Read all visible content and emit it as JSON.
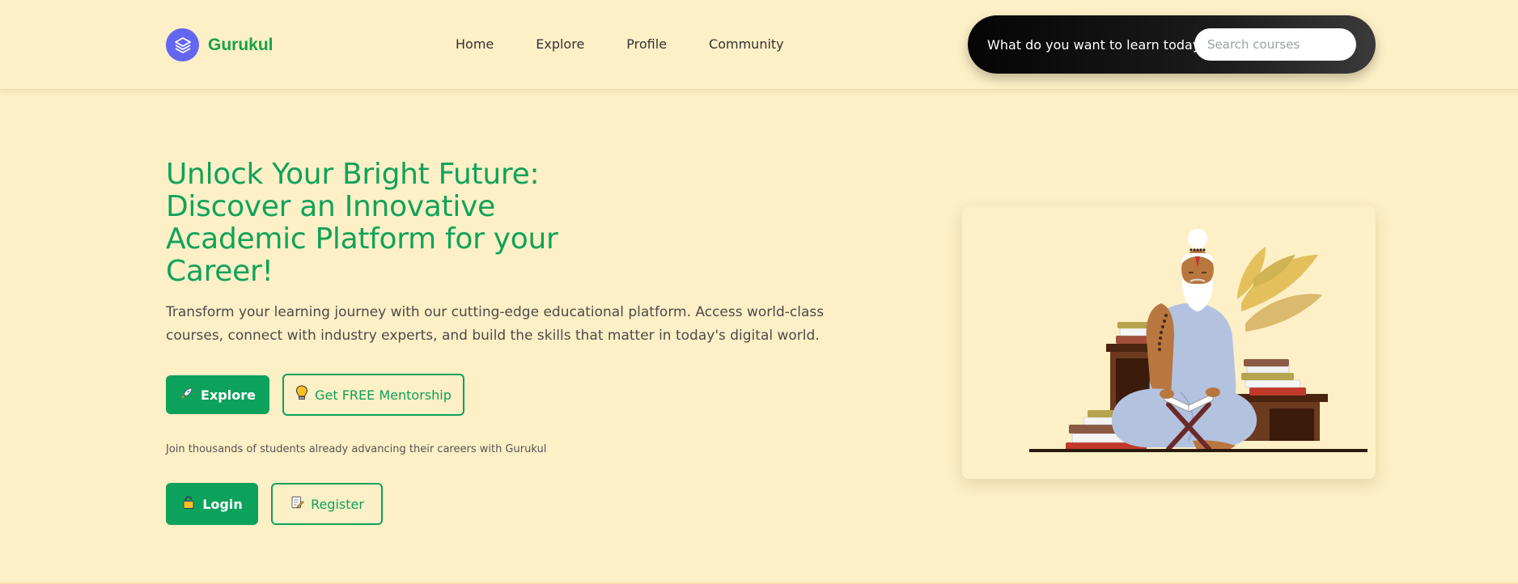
{
  "brand": {
    "name": "Gurukul",
    "logo_icon": "stack-layers-icon",
    "logo_color": "#6366f1"
  },
  "nav": {
    "items": [
      "Home",
      "Explore",
      "Profile",
      "Community"
    ]
  },
  "search": {
    "prompt": "What do you want to learn today?",
    "placeholder": "Search courses",
    "value": ""
  },
  "hero": {
    "title": "Unlock Your Bright Future: Discover an Innovative Academic Platform for your Career!",
    "description": "Transform your learning journey with our cutting-edge educational platform. Access world-class courses, connect with industry experts, and build the skills that matter in today's digital world."
  },
  "buttons": {
    "explore": {
      "label": "Explore",
      "icon": "rocket-icon"
    },
    "mentorship": {
      "label": "Get FREE Mentorship",
      "icon": "lightbulb-icon"
    },
    "login": {
      "label": "Login",
      "icon": "lock-icon"
    },
    "register": {
      "label": "Register",
      "icon": "memo-icon"
    }
  },
  "join_text": "Join thousands of students already advancing their careers with Gurukul",
  "illustration": {
    "icon": "sage-reading-illustration"
  },
  "colors": {
    "background": "#fdefc6",
    "accent_green": "#0da25b",
    "search_bar": "#111111"
  }
}
